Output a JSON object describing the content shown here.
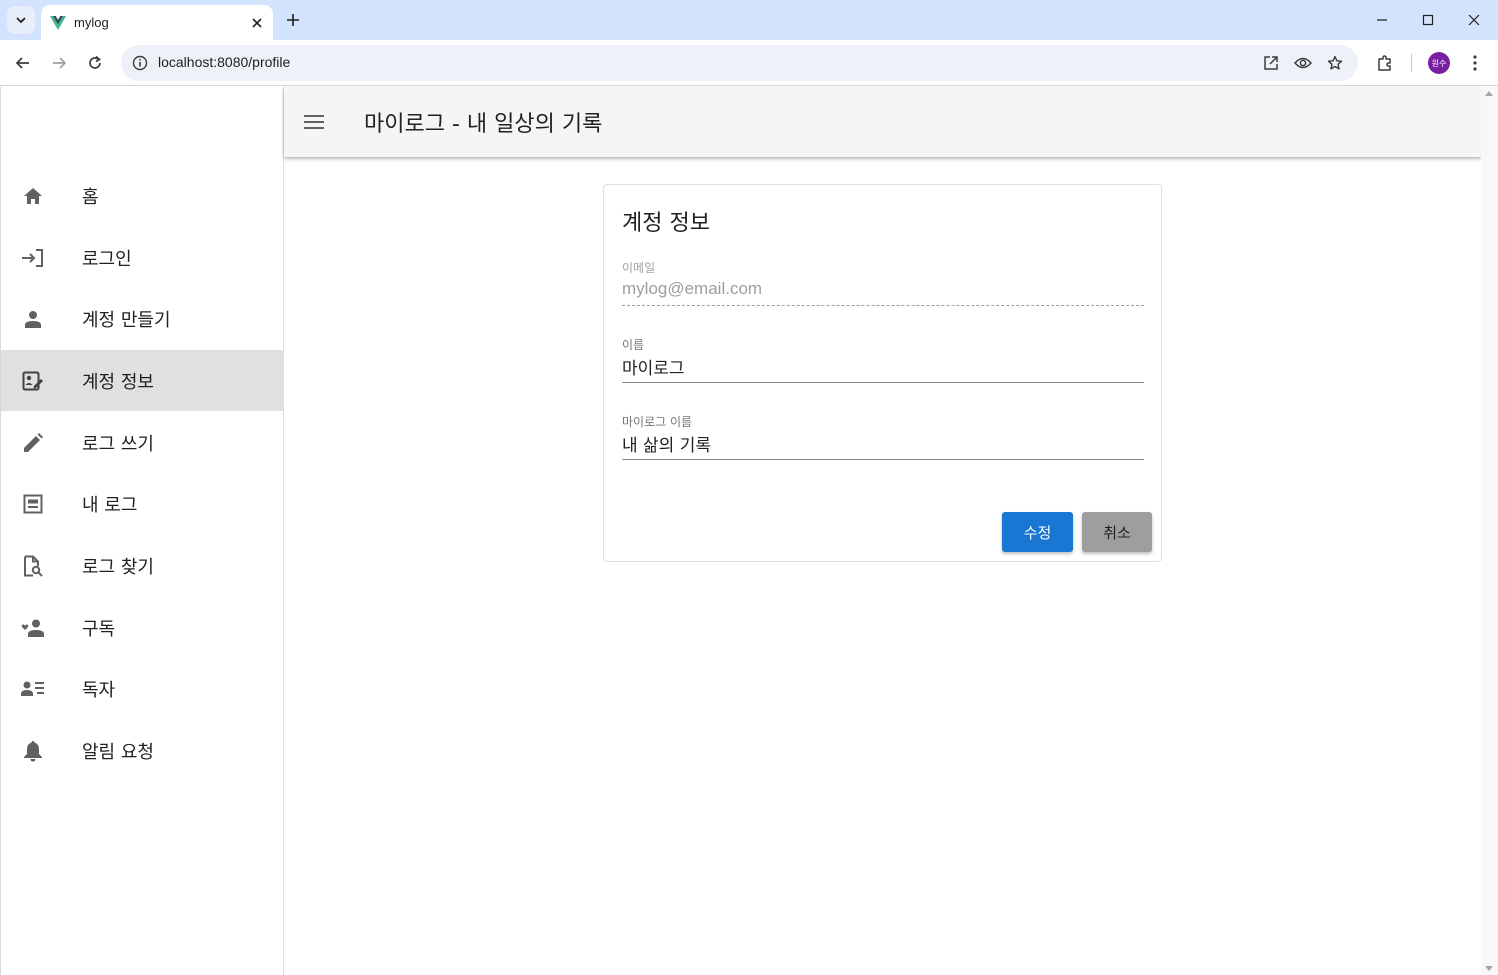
{
  "browser": {
    "tab_title": "mylog",
    "url": "localhost:8080/profile",
    "profile_initials": "원수"
  },
  "sidebar": {
    "items": [
      {
        "label": "홈",
        "icon": "home-icon"
      },
      {
        "label": "로그인",
        "icon": "login-icon"
      },
      {
        "label": "계정 만들기",
        "icon": "person-icon"
      },
      {
        "label": "계정 정보",
        "icon": "edit-profile-icon",
        "active": true
      },
      {
        "label": "로그 쓰기",
        "icon": "pencil-icon"
      },
      {
        "label": "내 로그",
        "icon": "article-icon"
      },
      {
        "label": "로그 찾기",
        "icon": "find-document-icon"
      },
      {
        "label": "구독",
        "icon": "subscribe-icon"
      },
      {
        "label": "독자",
        "icon": "readers-icon"
      },
      {
        "label": "알림 요청",
        "icon": "bell-icon"
      }
    ]
  },
  "appbar": {
    "title": "마이로그 - 내 일상의 기록"
  },
  "profile_card": {
    "title": "계정 정보",
    "email": {
      "label": "이메일",
      "value": "mylog@email.com"
    },
    "name": {
      "label": "이름",
      "value": "마이로그"
    },
    "mylog_name": {
      "label": "마이로그 이름",
      "value": "내 삶의 기록"
    },
    "submit_label": "수정",
    "cancel_label": "취소"
  },
  "colors": {
    "primary": "#1976d2",
    "secondary": "#9e9e9e",
    "active_nav": "#e0e0e0",
    "appbar": "#f5f5f5"
  }
}
